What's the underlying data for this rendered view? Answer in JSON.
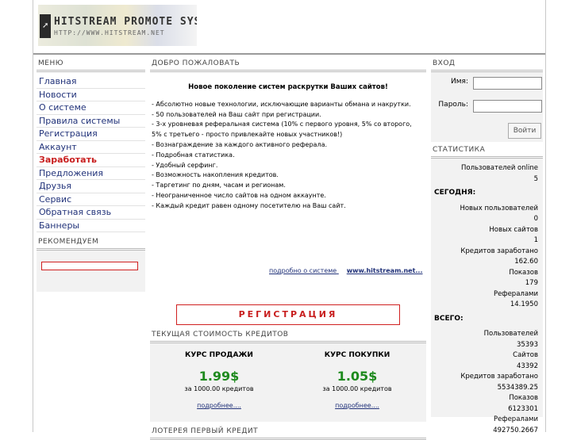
{
  "header": {
    "logo_title": "HITSTREAM PROMOTE SYSTEM",
    "logo_url": "HTTP://WWW.HITSTREAM.NET"
  },
  "menu": {
    "title": "МЕНЮ",
    "items": [
      {
        "label": "Главная"
      },
      {
        "label": "Новости"
      },
      {
        "label": "О системе"
      },
      {
        "label": "Правила системы"
      },
      {
        "label": "Регистрация"
      },
      {
        "label": "Аккаунт"
      },
      {
        "label": "Заработать"
      },
      {
        "label": "Предложения"
      },
      {
        "label": "Друзья"
      },
      {
        "label": "Сервис"
      },
      {
        "label": "Обратная связь"
      },
      {
        "label": "Баннеры"
      }
    ],
    "active_index": 6,
    "active_color": "#c81e1e"
  },
  "recommend": {
    "title": "РЕКОМЕНДУЕМ"
  },
  "welcome": {
    "title": "ДОБРО ПОЖАЛОВАТЬ",
    "headline": "Новое поколение систем раскрутки Ваших сайтов!",
    "lines": [
      "- Абсолютно новые технологии, исключающие варианты обмана и накрутки.",
      "- 50 пользователей на Ваш сайт при регистрации.",
      "- 3-х уровневая реферальная система (10% с первого уровня, 5% со второго,",
      "5% с третьего - просто привлекайте новых участников!)",
      "- Вознаграждение за каждого активного реферала.",
      "- Подробная статистика.",
      "- Удобный серфинг.",
      "- Возможность накопления кредитов.",
      "- Таргетинг по дням, часам и регионам.",
      "- Неограниченное число сайтов на одном аккаунте.",
      "- Каждый кредит равен одному посетителю на Ваш сайт."
    ],
    "more_link": "подробно о системе",
    "site_link": "www.hitstream.net...",
    "register_button": "РЕГИСТРАЦИЯ"
  },
  "rates": {
    "title": "ТЕКУЩАЯ СТОИМОСТЬ КРЕДИТОВ",
    "sell": {
      "label": "КУРС ПРОДАЖИ",
      "value": "1.99$",
      "sub": "за 1000.00 кредитов",
      "link": "подробнее...."
    },
    "buy": {
      "label": "КУРС ПОКУПКИ",
      "value": "1.05$",
      "sub": "за 1000.00 кредитов",
      "link": "подробнее...."
    },
    "value_color": "#1e8a1e"
  },
  "lottery": {
    "title": "ЛОТЕРЕЯ ПЕРВЫЙ КРЕДИТ"
  },
  "login": {
    "title": "ВХОД",
    "name_label": "Имя:",
    "password_label": "Пароль:",
    "submit": "Войти"
  },
  "stats": {
    "title": "СТАТИСТИКА",
    "online_label": "Пользователей online",
    "online_value": "5",
    "today_title": "СЕГОДНЯ:",
    "today": [
      {
        "label": "Новых пользователей",
        "value": "0"
      },
      {
        "label": "Новых сайтов",
        "value": "1"
      },
      {
        "label": "Кредитов заработано",
        "value": "162.60"
      },
      {
        "label": "Показов",
        "value": "179"
      },
      {
        "label": "Рефералами",
        "value": "14.1950"
      }
    ],
    "total_title": "ВСЕГО:",
    "total": [
      {
        "label": "Пользователей",
        "value": "35393"
      },
      {
        "label": "Сайтов",
        "value": "43392"
      },
      {
        "label": "Кредитов заработано",
        "value": "5534389.25"
      },
      {
        "label": "Показов",
        "value": "6123301"
      },
      {
        "label": "Рефералами",
        "value": "492750.2667"
      }
    ]
  }
}
